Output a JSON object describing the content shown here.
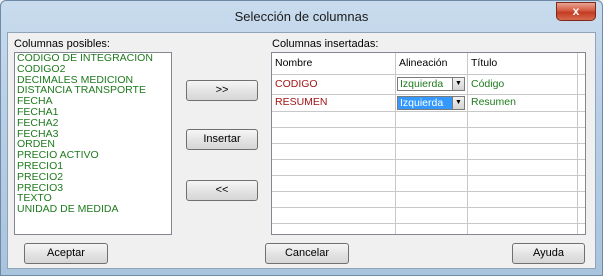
{
  "window": {
    "title": "Selección de columnas",
    "close_label": "x"
  },
  "left_panel": {
    "label": "Columnas posibles:",
    "items": [
      "CODIGO DE INTEGRACION",
      "CODIGO2",
      "DECIMALES MEDICION",
      "DISTANCIA TRANSPORTE",
      "FECHA",
      "FECHA1",
      "FECHA2",
      "FECHA3",
      "ORDEN",
      "PRECIO ACTIVO",
      "PRECIO1",
      "PRECIO2",
      "PRECIO3",
      "TEXTO",
      "UNIDAD DE MEDIDA"
    ]
  },
  "middle_buttons": {
    "add_all_label": ">>",
    "insert_label": "Insertar",
    "remove_all_label": "<<"
  },
  "right_panel": {
    "label": "Columnas insertadas:",
    "columns": [
      "Nombre",
      "Alineación",
      "Título"
    ],
    "rows": [
      {
        "name": "CODIGO",
        "alignment": "Izquierda",
        "title": "Código"
      },
      {
        "name": "RESUMEN",
        "alignment": "Izquierda",
        "title": "Resumen"
      }
    ]
  },
  "footer": {
    "accept_label": "Aceptar",
    "cancel_label": "Cancelar",
    "help_label": "Ayuda"
  },
  "colors": {
    "list_text": "#1e7a1e",
    "name_text": "#a31515",
    "selection": "#3399ff"
  }
}
